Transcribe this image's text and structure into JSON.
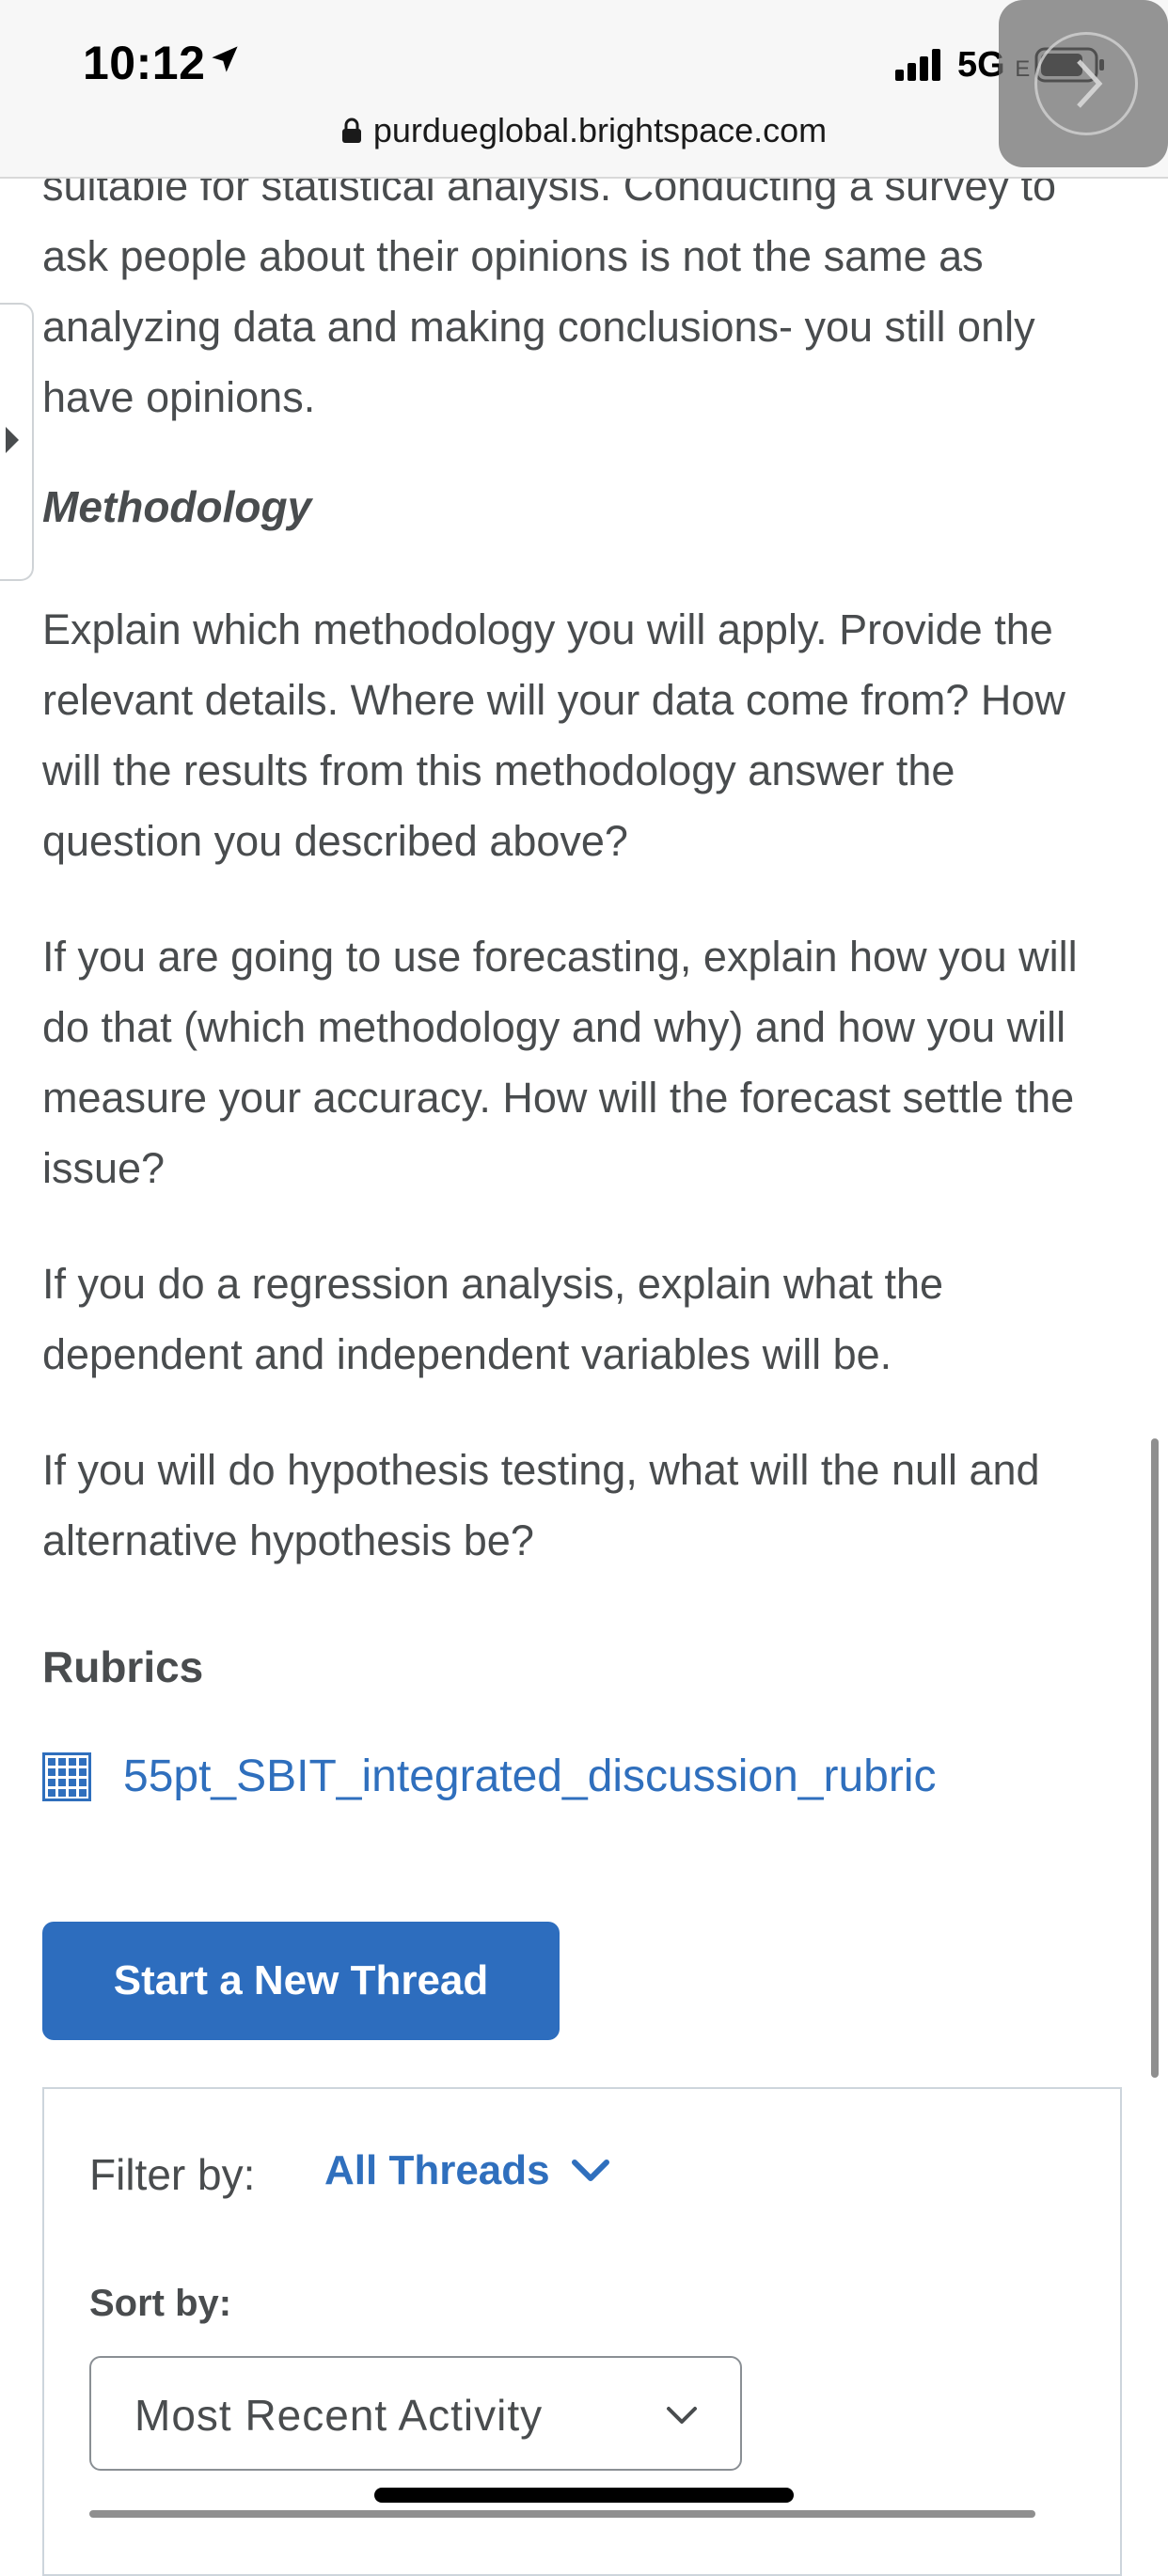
{
  "status_bar": {
    "time": "10:12",
    "network": "5G",
    "network_suffix": "E",
    "url": "purdueglobal.brightspace.com"
  },
  "content": {
    "paragraph_1": "suitable for statistical analysis. Conducting a survey to ask people about their opinions is not the same as analyzing data and making conclusions- you still only have opinions.",
    "methodology_heading": "Methodology",
    "paragraph_2": "Explain which methodology you will apply. Provide the relevant details. Where will your data come from? How will the results from this methodology answer the question you described above?",
    "paragraph_3": "If you are going to use forecasting, explain how you will do that (which methodology and why) and how you will measure your accuracy. How will the forecast settle the issue?",
    "paragraph_4": "If you do a regression analysis, explain what the dependent and independent variables will be.",
    "paragraph_5": "If you will do hypothesis testing, what will the null and alternative hypothesis be?",
    "rubrics_heading": "Rubrics",
    "rubric_link": "55pt_SBIT_integrated_discussion_rubric"
  },
  "actions": {
    "start_thread": "Start a New Thread"
  },
  "filters": {
    "filter_label": "Filter by:",
    "filter_value": "All Threads",
    "sort_label": "Sort by:",
    "sort_value": "Most Recent Activity"
  },
  "colors": {
    "text": "#494c4e",
    "link": "#2f6fbd",
    "button": "#2d6dbe"
  }
}
